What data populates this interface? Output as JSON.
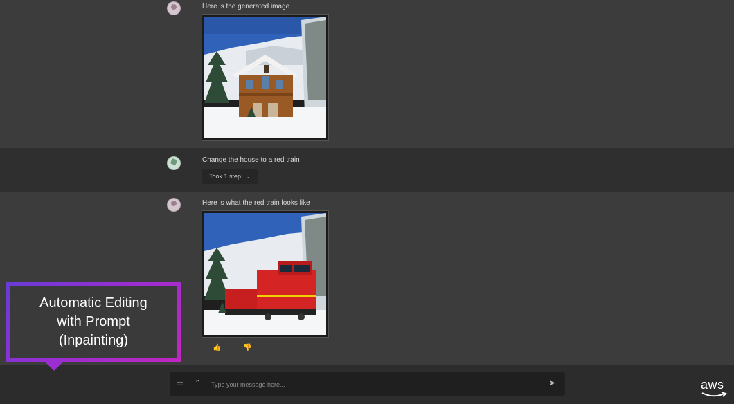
{
  "messages": [
    {
      "role": "assistant",
      "text": "Here is the generated image",
      "image": "snowy-log-cabin"
    },
    {
      "role": "user",
      "text": "Change the house to a red train",
      "step_label": "Took 1 step"
    },
    {
      "role": "assistant",
      "text": "Here is what the red train looks like",
      "image": "red-train-in-snow"
    }
  ],
  "feedback": {
    "up_icon": "thumbs-up-icon",
    "down_icon": "thumbs-down-icon"
  },
  "composer": {
    "placeholder": "Type your message here...",
    "settings_icon": "sliders-icon",
    "expand_icon": "chevron-double-up-icon",
    "send_icon": "send-icon"
  },
  "callout": {
    "text": "Automatic Editing\nwith Prompt\n(Inpainting)",
    "border_color": "#9a2ed1"
  },
  "brand": {
    "logo_text": "aws"
  }
}
